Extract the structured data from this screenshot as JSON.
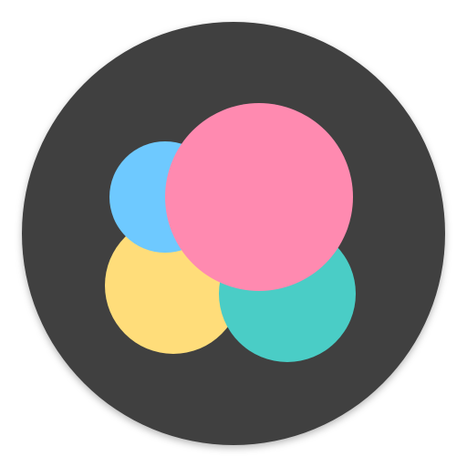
{
  "icon": {
    "name": "app-icon",
    "background_color": "#404040",
    "circles": [
      {
        "name": "yellow-circle",
        "color": "#FFDD7A"
      },
      {
        "name": "teal-circle",
        "color": "#4ACDC6"
      },
      {
        "name": "blue-circle",
        "color": "#6EC9FF"
      },
      {
        "name": "pink-circle",
        "color": "#FF8AB0"
      }
    ]
  }
}
